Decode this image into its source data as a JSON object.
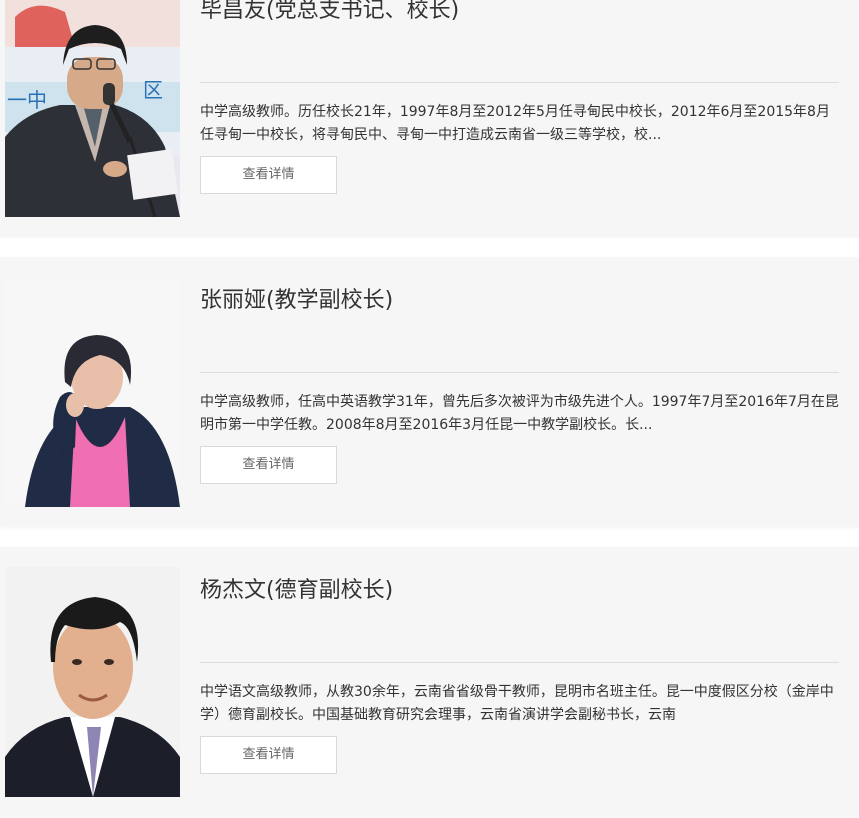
{
  "staff": [
    {
      "name": "毕昌友(党总支书记、校长)",
      "description": "中学高级教师。历任校长21年，1997年8月至2012年5月任寻甸民中校长，2012年6月至2015年8月任寻甸一中校长，将寻甸民中、寻甸一中打造成云南省一级三等学校，校...",
      "button_label": "查看详情"
    },
    {
      "name": "张丽娅(教学副校长)",
      "description": "中学高级教师，任高中英语教学31年，曾先后多次被评为市级先进个人。1997年7月至2016年7月在昆明市第一中学任教。2008年8月至2016年3月任昆一中教学副校长。长...",
      "button_label": "查看详情"
    },
    {
      "name": "杨杰文(德育副校长)",
      "description": "中学语文高级教师，从教30余年，云南省省级骨干教师，昆明市名班主任。昆一中度假区分校（金岸中学）德育副校长。中国基础教育研究会理事，云南省演讲学会副秘书长，云南",
      "button_label": "查看详情"
    }
  ],
  "colors": {
    "card_background": "#f6f6f6",
    "divider": "#dddddd",
    "text": "#333333",
    "button_text": "#666666"
  }
}
